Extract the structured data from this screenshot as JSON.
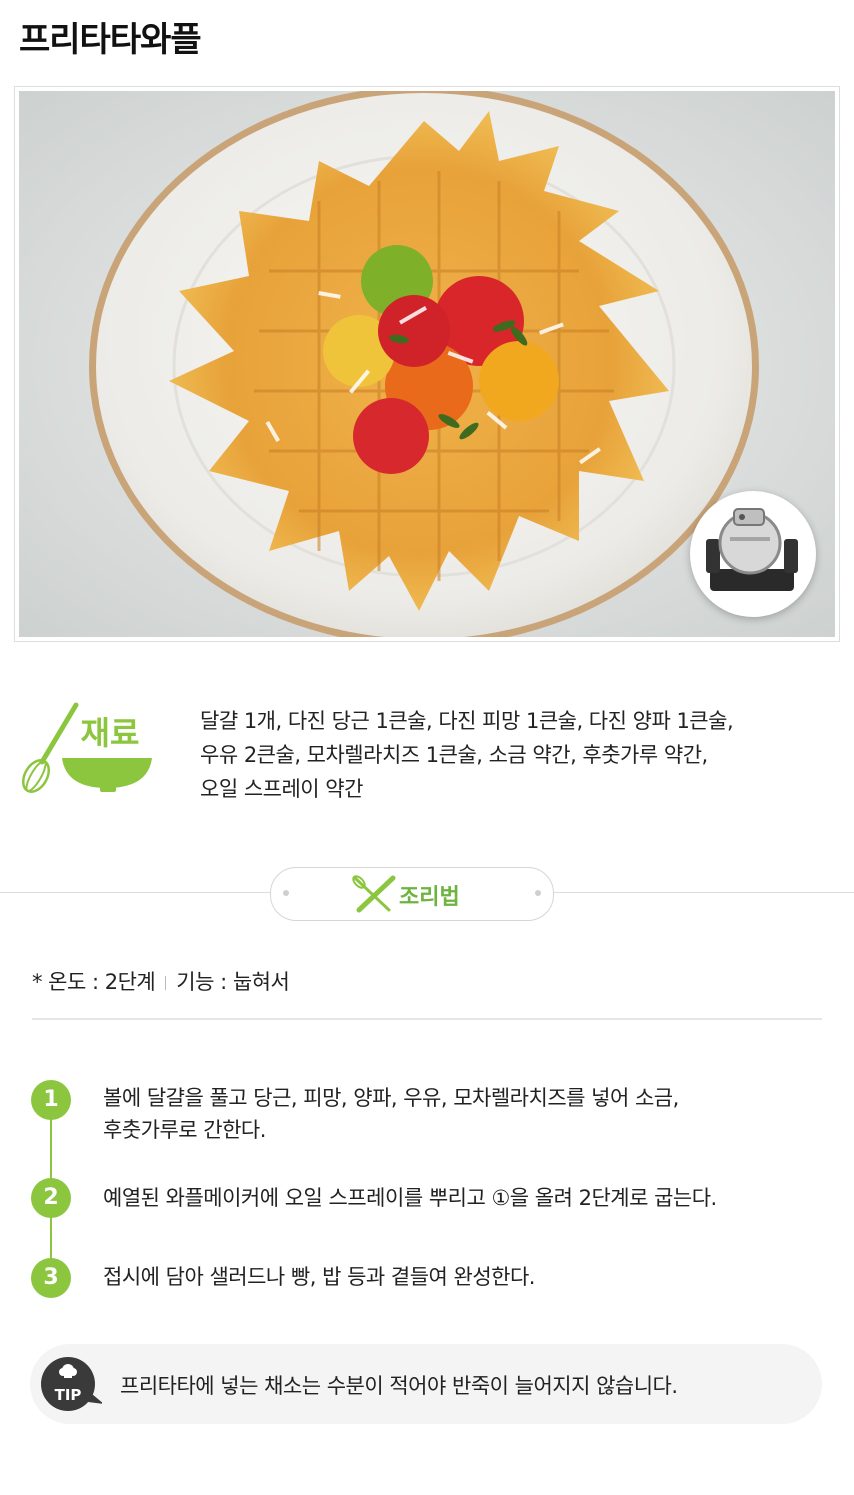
{
  "recipe": {
    "title": "프리타타와플"
  },
  "ingredients": {
    "heading": "재료",
    "lines": [
      "달걀 1개, 다진 당근 1큰술, 다진 피망 1큰술, 다진 양파 1큰술,",
      "우유 2큰술, 모차렐라치즈 1큰술, 소금 약간, 후춧가루 약간,",
      "오일 스프레이 약간"
    ]
  },
  "method": {
    "heading": "조리법",
    "settings": {
      "temperature": "* 온도 : 2단계",
      "function": "기능 : 눕혀서"
    },
    "steps": [
      {
        "number": "1",
        "lines": [
          "볼에 달걀을 풀고 당근, 피망, 양파, 우유, 모차렐라치즈를 넣어 소금,",
          "후춧가루로 간한다."
        ]
      },
      {
        "number": "2",
        "lines": [
          "예열된 와플메이커에 오일 스프레이를 뿌리고 ①을 올려 2단계로 굽는다."
        ]
      },
      {
        "number": "3",
        "lines": [
          "접시에 담아 샐러드나 빵, 밥 등과 곁들여 완성한다."
        ]
      }
    ]
  },
  "tip": {
    "label": "TIP",
    "text": "프리타타에 넣는 채소는 수분이 적어야 반죽이 늘어지지 않습니다."
  },
  "colors": {
    "accent_green": "#8cc63f",
    "heading_green": "#6db33f",
    "tip_dark": "#3a3a3a"
  }
}
